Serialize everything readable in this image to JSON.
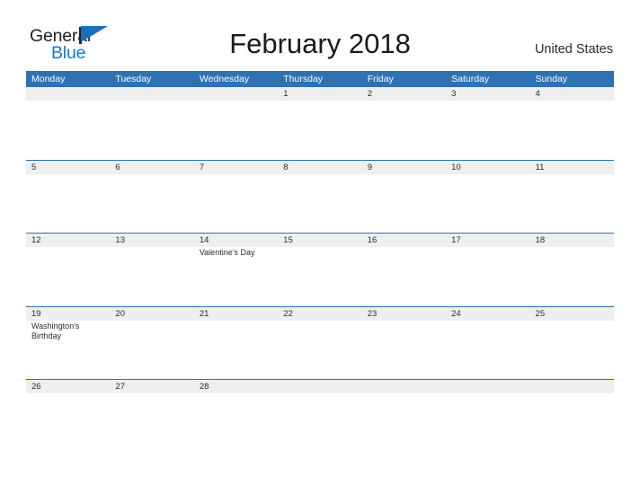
{
  "brand": {
    "name_part1": "General",
    "name_part2": "Blue",
    "flag_icon": "flag-triangle-icon",
    "color_dark": "#231f20",
    "color_blue": "#1278c6"
  },
  "header": {
    "title": "February 2018",
    "country": "United States"
  },
  "calendar": {
    "header_color": "#2e72b4",
    "band_color": "#efefef",
    "weekdays": [
      "Monday",
      "Tuesday",
      "Wednesday",
      "Thursday",
      "Friday",
      "Saturday",
      "Sunday"
    ],
    "weeks": [
      [
        {
          "day": "",
          "event": ""
        },
        {
          "day": "",
          "event": ""
        },
        {
          "day": "",
          "event": ""
        },
        {
          "day": "1",
          "event": ""
        },
        {
          "day": "2",
          "event": ""
        },
        {
          "day": "3",
          "event": ""
        },
        {
          "day": "4",
          "event": ""
        }
      ],
      [
        {
          "day": "5",
          "event": ""
        },
        {
          "day": "6",
          "event": ""
        },
        {
          "day": "7",
          "event": ""
        },
        {
          "day": "8",
          "event": ""
        },
        {
          "day": "9",
          "event": ""
        },
        {
          "day": "10",
          "event": ""
        },
        {
          "day": "11",
          "event": ""
        }
      ],
      [
        {
          "day": "12",
          "event": ""
        },
        {
          "day": "13",
          "event": ""
        },
        {
          "day": "14",
          "event": "Valentine’s Day"
        },
        {
          "day": "15",
          "event": ""
        },
        {
          "day": "16",
          "event": ""
        },
        {
          "day": "17",
          "event": ""
        },
        {
          "day": "18",
          "event": ""
        }
      ],
      [
        {
          "day": "19",
          "event": "Washington's Birthday"
        },
        {
          "day": "20",
          "event": ""
        },
        {
          "day": "21",
          "event": ""
        },
        {
          "day": "22",
          "event": ""
        },
        {
          "day": "23",
          "event": ""
        },
        {
          "day": "24",
          "event": ""
        },
        {
          "day": "25",
          "event": ""
        }
      ],
      [
        {
          "day": "26",
          "event": ""
        },
        {
          "day": "27",
          "event": ""
        },
        {
          "day": "28",
          "event": ""
        },
        {
          "day": "",
          "event": ""
        },
        {
          "day": "",
          "event": ""
        },
        {
          "day": "",
          "event": ""
        },
        {
          "day": "",
          "event": ""
        }
      ]
    ]
  }
}
